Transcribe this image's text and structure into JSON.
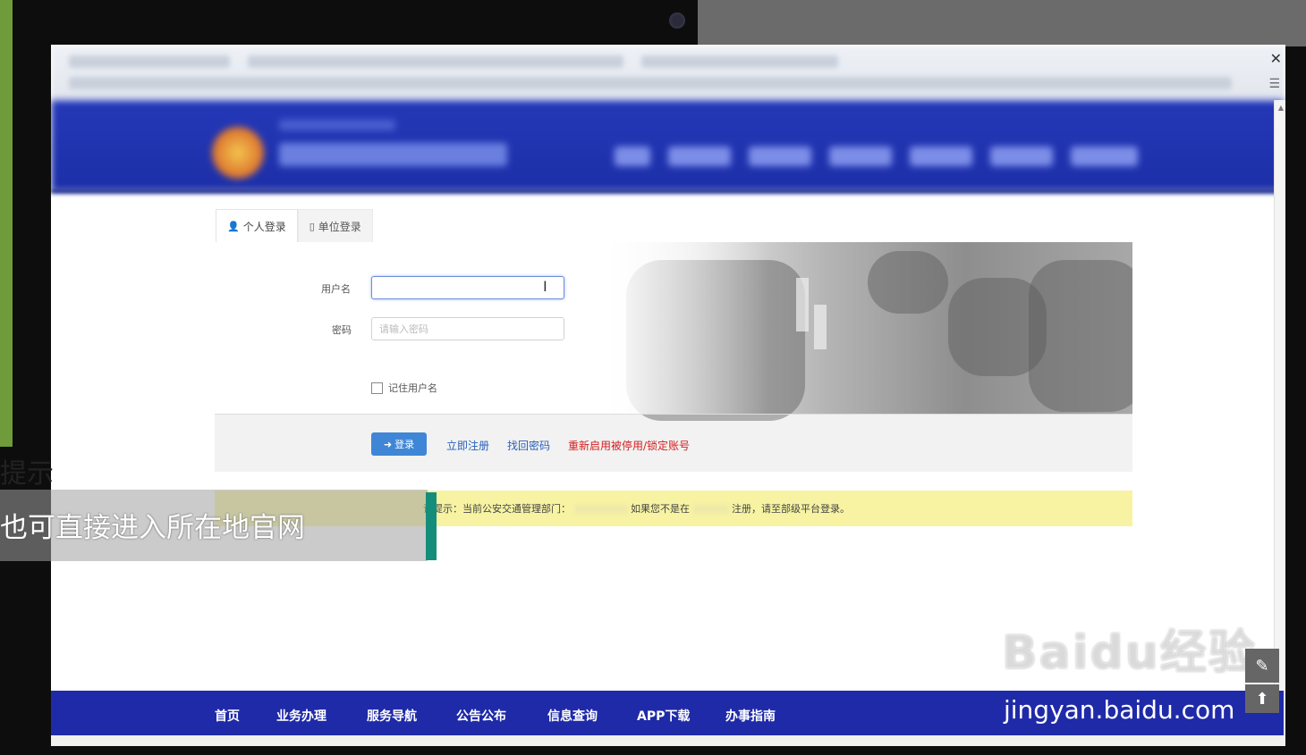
{
  "tabs": [
    {
      "label": "个人登录",
      "icon": "user-icon"
    },
    {
      "label": "单位登录",
      "icon": "building-icon"
    }
  ],
  "form": {
    "username_label": "用户名",
    "username_value": "",
    "password_label": "密码",
    "password_placeholder": "请输入密码",
    "remember_label": "记住用户名"
  },
  "actions": {
    "login_label": "登录",
    "register_label": "立即注册",
    "recover_label": "找回密码",
    "reactivate_label": "重新启用被停用/锁定账号"
  },
  "notice": {
    "part1": "请提示：当前公安交通管理部门：",
    "part2": "如果您不是在",
    "part3": "注册，请至部级平台登录。"
  },
  "footer_nav": [
    "首页",
    "业务办理",
    "服务导航",
    "公告公布",
    "信息查询",
    "APP下载",
    "办事指南"
  ],
  "overlay": {
    "caption_title": "提示",
    "caption_text": "也可直接进入所在地官网",
    "watermark_url": "jingyan.baidu.com",
    "watermark_logo": "Baidu经验"
  },
  "colors": {
    "header_blue": "#1c2fa8",
    "login_button": "#3f86d7",
    "link_blue": "#2a5fb8",
    "link_red": "#d21f1f",
    "notice_yellow": "#f7f3a3",
    "caption_accent": "#148e7a"
  }
}
